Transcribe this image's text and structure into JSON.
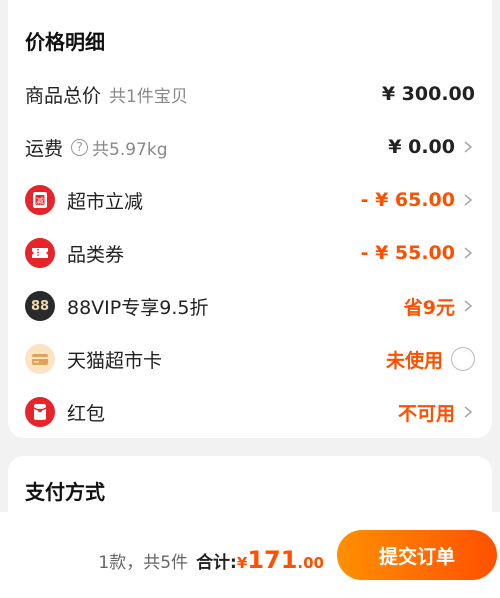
{
  "price_section": {
    "title": "价格明细",
    "rows": [
      {
        "label": "商品总价",
        "sub": "共1件宝贝",
        "value": "¥ 300.00"
      },
      {
        "label": "运费",
        "sub": "共5.97kg",
        "value": "¥ 0.00"
      },
      {
        "label": "超市立减",
        "value": "- ¥ 65.00"
      },
      {
        "label": "品类券",
        "value": "- ¥ 55.00"
      },
      {
        "label": "88VIP专享9.5折",
        "value": "省9元",
        "badge": "88"
      },
      {
        "label": "天猫超市卡",
        "value": "未使用"
      },
      {
        "label": "红包",
        "value": "不可用"
      }
    ]
  },
  "payment_section": {
    "title": "支付方式"
  },
  "bottom_bar": {
    "count_text": "1款，共5件",
    "total_label": "合计:",
    "yen": "¥",
    "amount": "171",
    "cents": ".00",
    "submit_label": "提交订单"
  },
  "colors": {
    "accent": "#ff5000",
    "red_icon": "#e8242b",
    "card_icon_bg": "#fbe3c4"
  }
}
